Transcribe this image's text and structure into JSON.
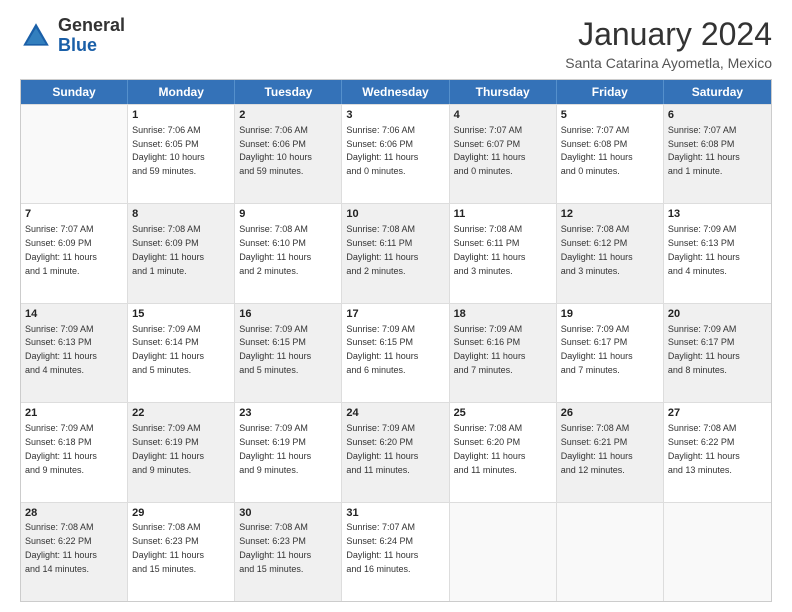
{
  "logo": {
    "general": "General",
    "blue": "Blue",
    "icon_color": "#1a5fa8"
  },
  "title": "January 2024",
  "subtitle": "Santa Catarina Ayometla, Mexico",
  "days_of_week": [
    "Sunday",
    "Monday",
    "Tuesday",
    "Wednesday",
    "Thursday",
    "Friday",
    "Saturday"
  ],
  "weeks": [
    [
      {
        "day": "",
        "info": "",
        "shaded": false,
        "empty": true
      },
      {
        "day": "1",
        "info": "Sunrise: 7:06 AM\nSunset: 6:05 PM\nDaylight: 10 hours\nand 59 minutes.",
        "shaded": false,
        "empty": false
      },
      {
        "day": "2",
        "info": "Sunrise: 7:06 AM\nSunset: 6:06 PM\nDaylight: 10 hours\nand 59 minutes.",
        "shaded": true,
        "empty": false
      },
      {
        "day": "3",
        "info": "Sunrise: 7:06 AM\nSunset: 6:06 PM\nDaylight: 11 hours\nand 0 minutes.",
        "shaded": false,
        "empty": false
      },
      {
        "day": "4",
        "info": "Sunrise: 7:07 AM\nSunset: 6:07 PM\nDaylight: 11 hours\nand 0 minutes.",
        "shaded": true,
        "empty": false
      },
      {
        "day": "5",
        "info": "Sunrise: 7:07 AM\nSunset: 6:08 PM\nDaylight: 11 hours\nand 0 minutes.",
        "shaded": false,
        "empty": false
      },
      {
        "day": "6",
        "info": "Sunrise: 7:07 AM\nSunset: 6:08 PM\nDaylight: 11 hours\nand 1 minute.",
        "shaded": true,
        "empty": false
      }
    ],
    [
      {
        "day": "7",
        "info": "Sunrise: 7:07 AM\nSunset: 6:09 PM\nDaylight: 11 hours\nand 1 minute.",
        "shaded": false,
        "empty": false
      },
      {
        "day": "8",
        "info": "Sunrise: 7:08 AM\nSunset: 6:09 PM\nDaylight: 11 hours\nand 1 minute.",
        "shaded": true,
        "empty": false
      },
      {
        "day": "9",
        "info": "Sunrise: 7:08 AM\nSunset: 6:10 PM\nDaylight: 11 hours\nand 2 minutes.",
        "shaded": false,
        "empty": false
      },
      {
        "day": "10",
        "info": "Sunrise: 7:08 AM\nSunset: 6:11 PM\nDaylight: 11 hours\nand 2 minutes.",
        "shaded": true,
        "empty": false
      },
      {
        "day": "11",
        "info": "Sunrise: 7:08 AM\nSunset: 6:11 PM\nDaylight: 11 hours\nand 3 minutes.",
        "shaded": false,
        "empty": false
      },
      {
        "day": "12",
        "info": "Sunrise: 7:08 AM\nSunset: 6:12 PM\nDaylight: 11 hours\nand 3 minutes.",
        "shaded": true,
        "empty": false
      },
      {
        "day": "13",
        "info": "Sunrise: 7:09 AM\nSunset: 6:13 PM\nDaylight: 11 hours\nand 4 minutes.",
        "shaded": false,
        "empty": false
      }
    ],
    [
      {
        "day": "14",
        "info": "Sunrise: 7:09 AM\nSunset: 6:13 PM\nDaylight: 11 hours\nand 4 minutes.",
        "shaded": true,
        "empty": false
      },
      {
        "day": "15",
        "info": "Sunrise: 7:09 AM\nSunset: 6:14 PM\nDaylight: 11 hours\nand 5 minutes.",
        "shaded": false,
        "empty": false
      },
      {
        "day": "16",
        "info": "Sunrise: 7:09 AM\nSunset: 6:15 PM\nDaylight: 11 hours\nand 5 minutes.",
        "shaded": true,
        "empty": false
      },
      {
        "day": "17",
        "info": "Sunrise: 7:09 AM\nSunset: 6:15 PM\nDaylight: 11 hours\nand 6 minutes.",
        "shaded": false,
        "empty": false
      },
      {
        "day": "18",
        "info": "Sunrise: 7:09 AM\nSunset: 6:16 PM\nDaylight: 11 hours\nand 7 minutes.",
        "shaded": true,
        "empty": false
      },
      {
        "day": "19",
        "info": "Sunrise: 7:09 AM\nSunset: 6:17 PM\nDaylight: 11 hours\nand 7 minutes.",
        "shaded": false,
        "empty": false
      },
      {
        "day": "20",
        "info": "Sunrise: 7:09 AM\nSunset: 6:17 PM\nDaylight: 11 hours\nand 8 minutes.",
        "shaded": true,
        "empty": false
      }
    ],
    [
      {
        "day": "21",
        "info": "Sunrise: 7:09 AM\nSunset: 6:18 PM\nDaylight: 11 hours\nand 9 minutes.",
        "shaded": false,
        "empty": false
      },
      {
        "day": "22",
        "info": "Sunrise: 7:09 AM\nSunset: 6:19 PM\nDaylight: 11 hours\nand 9 minutes.",
        "shaded": true,
        "empty": false
      },
      {
        "day": "23",
        "info": "Sunrise: 7:09 AM\nSunset: 6:19 PM\nDaylight: 11 hours\nand 9 minutes.",
        "shaded": false,
        "empty": false
      },
      {
        "day": "24",
        "info": "Sunrise: 7:09 AM\nSunset: 6:20 PM\nDaylight: 11 hours\nand 11 minutes.",
        "shaded": true,
        "empty": false
      },
      {
        "day": "25",
        "info": "Sunrise: 7:08 AM\nSunset: 6:20 PM\nDaylight: 11 hours\nand 11 minutes.",
        "shaded": false,
        "empty": false
      },
      {
        "day": "26",
        "info": "Sunrise: 7:08 AM\nSunset: 6:21 PM\nDaylight: 11 hours\nand 12 minutes.",
        "shaded": true,
        "empty": false
      },
      {
        "day": "27",
        "info": "Sunrise: 7:08 AM\nSunset: 6:22 PM\nDaylight: 11 hours\nand 13 minutes.",
        "shaded": false,
        "empty": false
      }
    ],
    [
      {
        "day": "28",
        "info": "Sunrise: 7:08 AM\nSunset: 6:22 PM\nDaylight: 11 hours\nand 14 minutes.",
        "shaded": true,
        "empty": false
      },
      {
        "day": "29",
        "info": "Sunrise: 7:08 AM\nSunset: 6:23 PM\nDaylight: 11 hours\nand 15 minutes.",
        "shaded": false,
        "empty": false
      },
      {
        "day": "30",
        "info": "Sunrise: 7:08 AM\nSunset: 6:23 PM\nDaylight: 11 hours\nand 15 minutes.",
        "shaded": true,
        "empty": false
      },
      {
        "day": "31",
        "info": "Sunrise: 7:07 AM\nSunset: 6:24 PM\nDaylight: 11 hours\nand 16 minutes.",
        "shaded": false,
        "empty": false
      },
      {
        "day": "",
        "info": "",
        "shaded": false,
        "empty": true
      },
      {
        "day": "",
        "info": "",
        "shaded": false,
        "empty": true
      },
      {
        "day": "",
        "info": "",
        "shaded": false,
        "empty": true
      }
    ]
  ]
}
